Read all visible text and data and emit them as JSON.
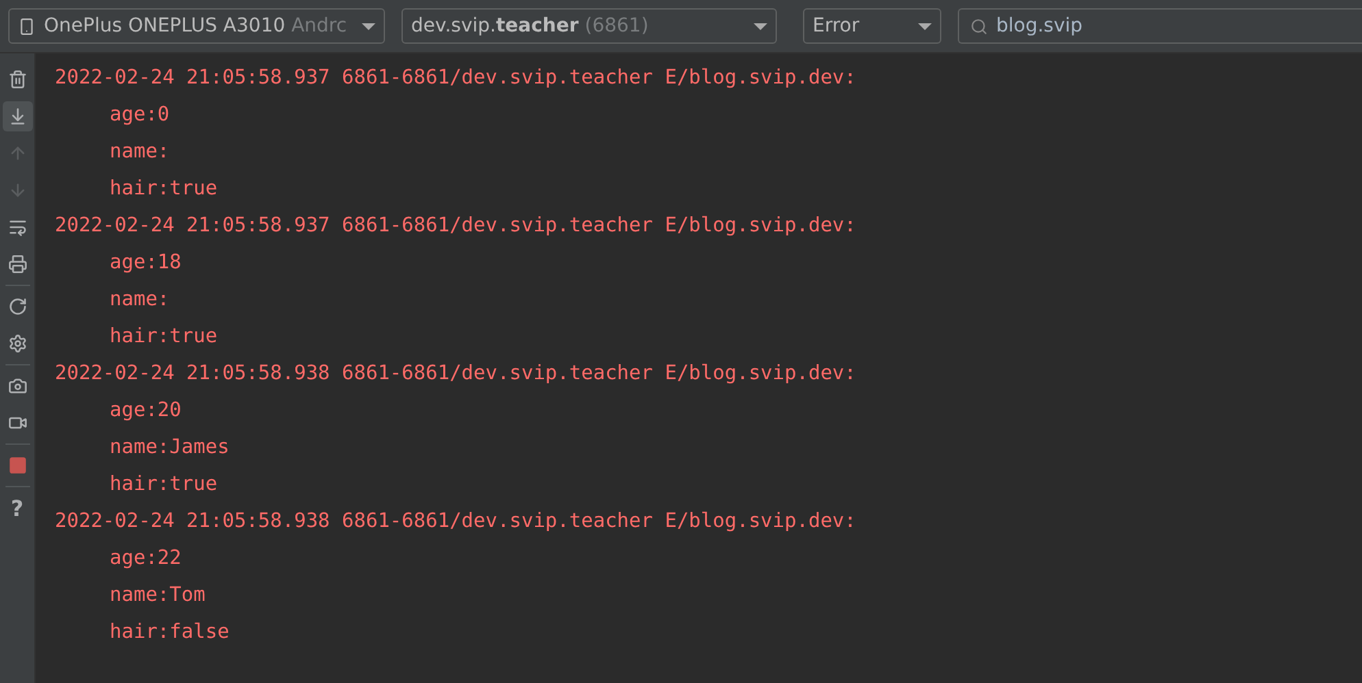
{
  "toolbar": {
    "device": {
      "name": "OnePlus ONEPLUS A3010",
      "suffix": "Andrc"
    },
    "process": {
      "name": "dev.svip.**teacher**",
      "pid": "(6861)"
    },
    "level": {
      "value": "Error"
    },
    "search": {
      "value": "blog.svip"
    }
  },
  "tools": [
    {
      "kind": "trash",
      "selected": false,
      "disabled": false
    },
    {
      "kind": "scroll-end",
      "selected": true,
      "disabled": false
    },
    {
      "kind": "up",
      "selected": false,
      "disabled": true
    },
    {
      "kind": "down",
      "selected": false,
      "disabled": true
    },
    {
      "kind": "wrap",
      "selected": false,
      "disabled": false
    },
    {
      "kind": "print",
      "selected": false,
      "disabled": false,
      "separator_after": true
    },
    {
      "kind": "restart",
      "selected": false,
      "disabled": false
    },
    {
      "kind": "settings",
      "selected": false,
      "disabled": false,
      "separator_after": true
    },
    {
      "kind": "camera",
      "selected": false,
      "disabled": false
    },
    {
      "kind": "video",
      "selected": false,
      "disabled": false,
      "separator_after": true
    },
    {
      "kind": "stop",
      "selected": false,
      "disabled": false,
      "separator_after": true
    },
    {
      "kind": "help",
      "label": "?",
      "selected": false,
      "disabled": false
    }
  ],
  "log": [
    {
      "header": "2022-02-24 21:05:58.937 6861-6861/dev.svip.teacher E/blog.svip.dev:",
      "lines": [
        "age:0",
        "name:",
        "hair:true"
      ]
    },
    {
      "header": "2022-02-24 21:05:58.937 6861-6861/dev.svip.teacher E/blog.svip.dev:",
      "lines": [
        "age:18",
        "name:",
        "hair:true"
      ]
    },
    {
      "header": "2022-02-24 21:05:58.938 6861-6861/dev.svip.teacher E/blog.svip.dev:",
      "lines": [
        "age:20",
        "name:James",
        "hair:true"
      ]
    },
    {
      "header": "2022-02-24 21:05:58.938 6861-6861/dev.svip.teacher E/blog.svip.dev:",
      "lines": [
        "age:22",
        "name:Tom",
        "hair:false"
      ]
    }
  ]
}
